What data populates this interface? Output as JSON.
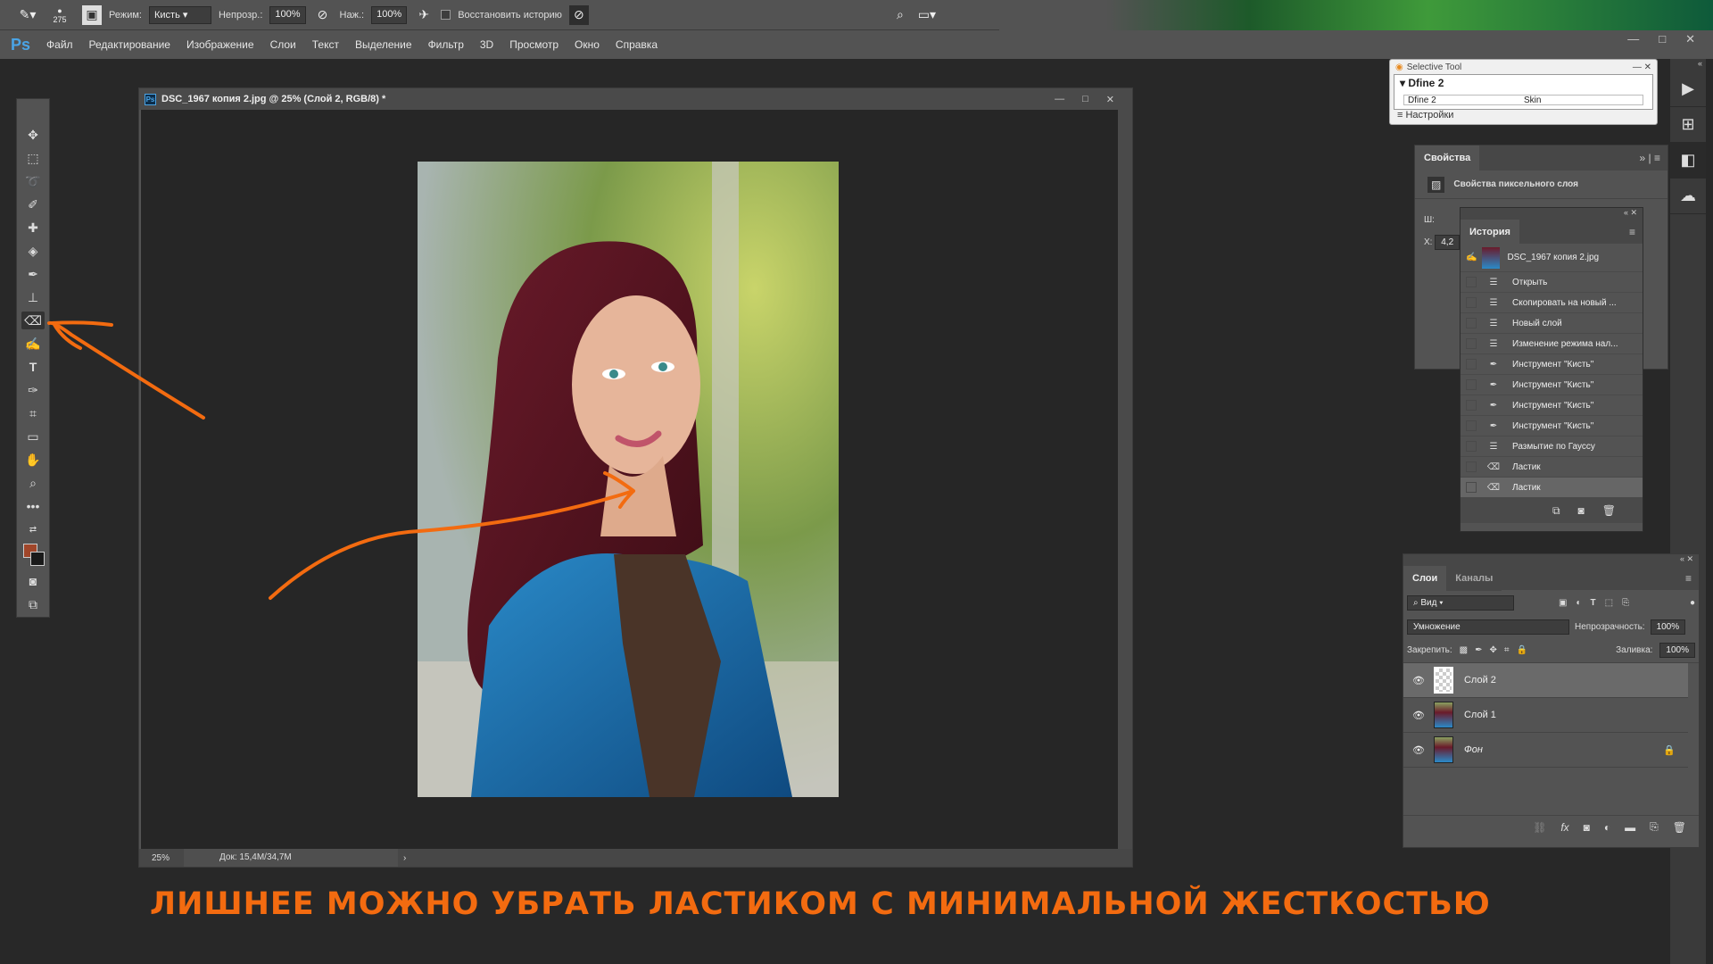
{
  "options_bar": {
    "brush_size": "275",
    "mode_label": "Режим:",
    "mode_value": "Кисть",
    "opacity_label": "Непрозр.:",
    "opacity_value": "100%",
    "flow_label": "Наж.:",
    "flow_value": "100%",
    "restore_history_label": "Восстановить историю",
    "restore_history_checked": false
  },
  "menu": {
    "logo": "Ps",
    "items": [
      "Файл",
      "Редактирование",
      "Изображение",
      "Слои",
      "Текст",
      "Выделение",
      "Фильтр",
      "3D",
      "Просмотр",
      "Окно",
      "Справка"
    ]
  },
  "document": {
    "title": "DSC_1967 копия 2.jpg @ 25% (Слой 2, RGB/8) *",
    "zoom": "25%",
    "doc_size": "Док: 15,4M/34,7M"
  },
  "caption": "ЛИШНЕЕ МОЖНО УБРАТЬ ЛАСТИКОМ С МИНИМАЛЬНОЙ ЖЕСТКОСТЬЮ",
  "selective_tool": {
    "title": "Selective Tool",
    "group": "Dfine 2",
    "col1": "Dfine 2",
    "col2": "Skin",
    "settings": "Настройки"
  },
  "properties": {
    "tab": "Свойства",
    "subtitle": "Свойства пиксельного слоя",
    "w_label": "Ш:",
    "x_label": "X:",
    "x_value": "4,2"
  },
  "history": {
    "tab": "История",
    "snapshot": "DSC_1967 копия 2.jpg",
    "items": [
      {
        "label": "Открыть",
        "icon": "document-icon"
      },
      {
        "label": "Скопировать на новый ...",
        "icon": "document-icon"
      },
      {
        "label": "Новый слой",
        "icon": "document-icon"
      },
      {
        "label": "Изменение режима нал...",
        "icon": "document-icon"
      },
      {
        "label": "Инструмент \"Кисть\"",
        "icon": "brush-icon"
      },
      {
        "label": "Инструмент \"Кисть\"",
        "icon": "brush-icon"
      },
      {
        "label": "Инструмент \"Кисть\"",
        "icon": "brush-icon"
      },
      {
        "label": "Инструмент \"Кисть\"",
        "icon": "brush-icon"
      },
      {
        "label": "Размытие по Гауссу",
        "icon": "document-icon"
      },
      {
        "label": "Ластик",
        "icon": "eraser-icon"
      },
      {
        "label": "Ластик",
        "icon": "eraser-icon"
      }
    ]
  },
  "layers": {
    "tabs": [
      "Слои",
      "Каналы"
    ],
    "filter": "Вид",
    "blend_mode": "Умножение",
    "opacity_label": "Непрозрачность:",
    "opacity_value": "100%",
    "lock_label": "Закрепить:",
    "fill_label": "Заливка:",
    "fill_value": "100%",
    "items": [
      {
        "name": "Слой 2",
        "selected": true,
        "visible": true
      },
      {
        "name": "Слой 1",
        "selected": false,
        "visible": true
      },
      {
        "name": "Фон",
        "selected": false,
        "visible": true,
        "locked": true
      }
    ]
  },
  "colors": {
    "accent_annotation": "#f36b10",
    "foreground": "#a0462a",
    "background": "#1a1a1a",
    "ps_blue": "#4aa4e6"
  },
  "active_tool": "eraser"
}
